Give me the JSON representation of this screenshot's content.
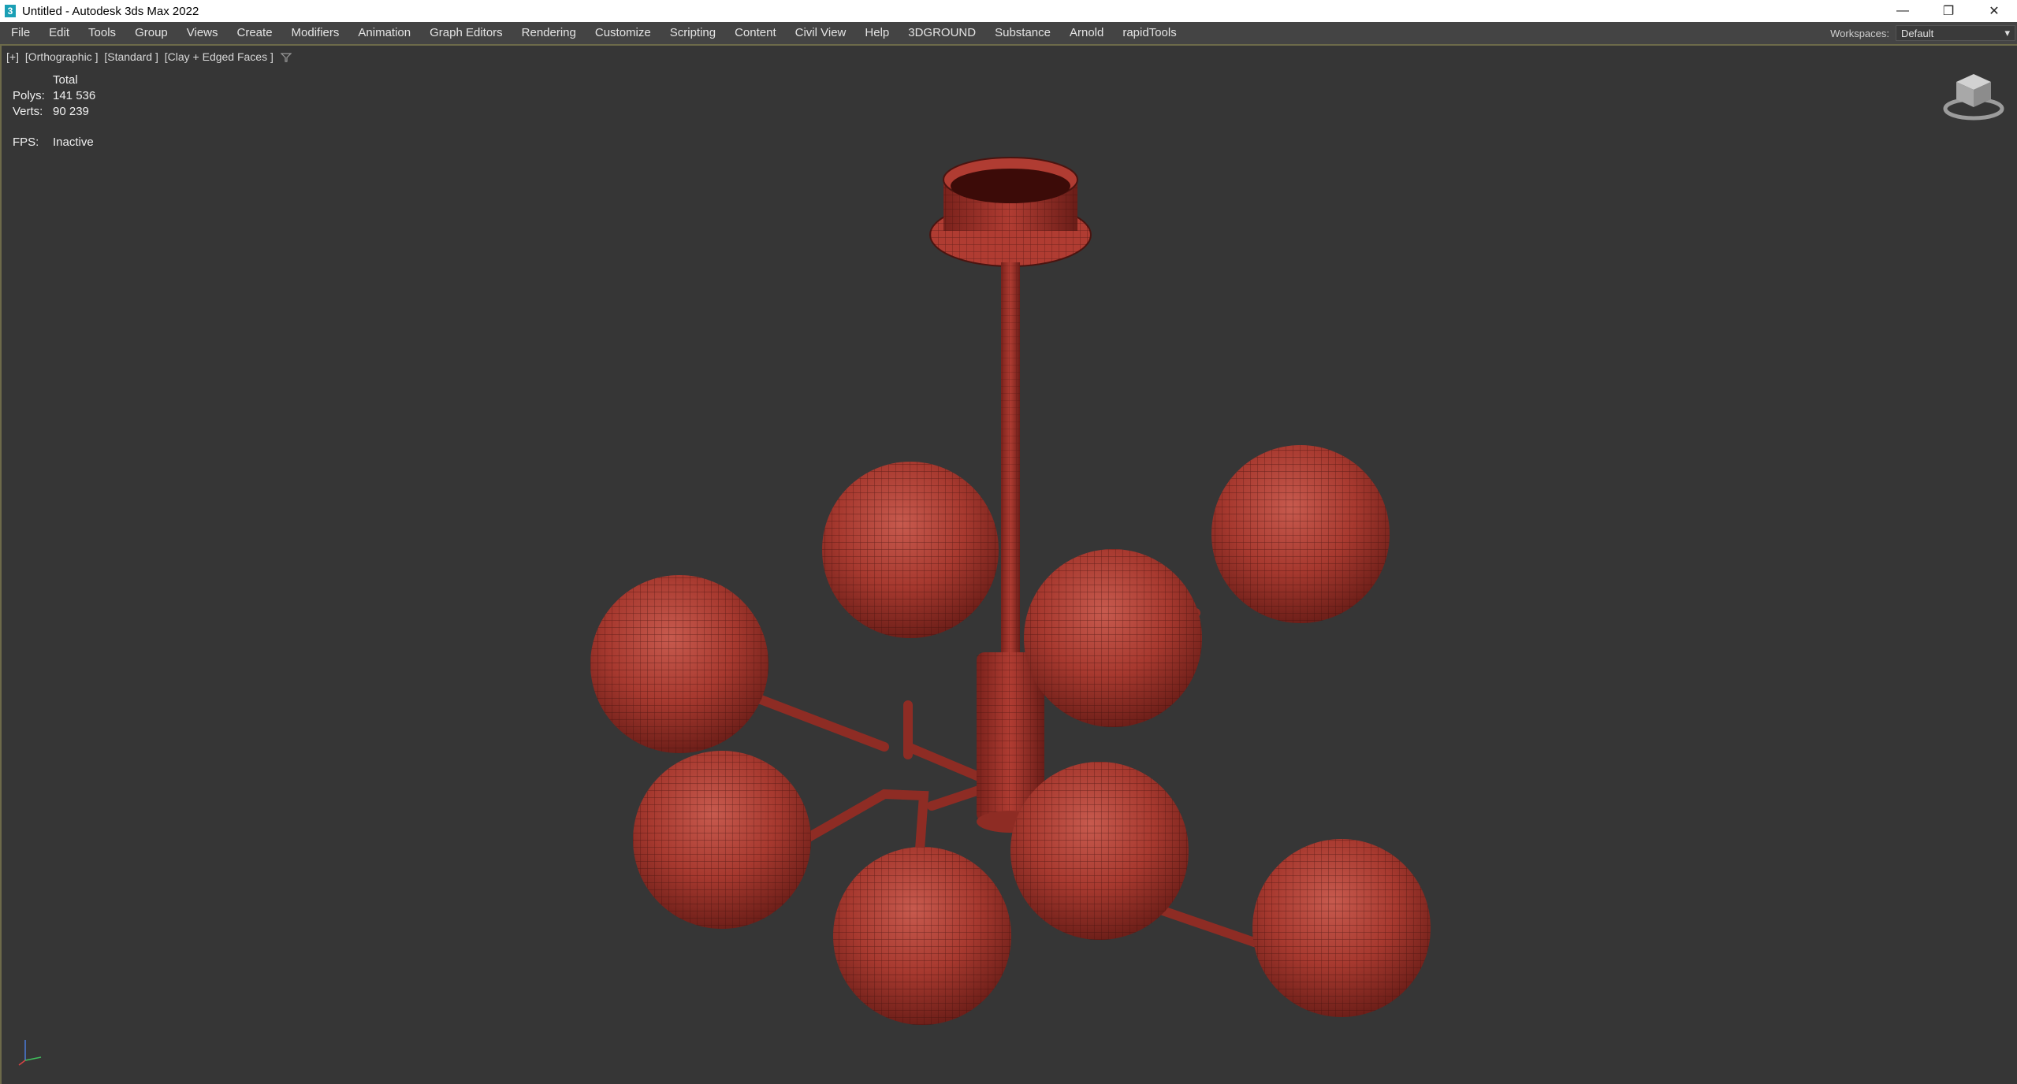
{
  "window": {
    "title": "Untitled - Autodesk 3ds Max 2022",
    "app_icon_glyph": "3",
    "controls": {
      "minimize": "—",
      "restore": "❐",
      "close": "✕"
    }
  },
  "menubar": {
    "items": [
      {
        "label": "File"
      },
      {
        "label": "Edit"
      },
      {
        "label": "Tools"
      },
      {
        "label": "Group"
      },
      {
        "label": "Views"
      },
      {
        "label": "Create"
      },
      {
        "label": "Modifiers"
      },
      {
        "label": "Animation"
      },
      {
        "label": "Graph Editors"
      },
      {
        "label": "Rendering"
      },
      {
        "label": "Customize"
      },
      {
        "label": "Scripting"
      },
      {
        "label": "Content"
      },
      {
        "label": "Civil View"
      },
      {
        "label": "Help"
      },
      {
        "label": "3DGROUND"
      },
      {
        "label": "Substance"
      },
      {
        "label": "Arnold"
      },
      {
        "label": "rapidTools"
      }
    ],
    "workspace_label": "Workspaces:",
    "workspace_value": "Default"
  },
  "viewport": {
    "labels": [
      "[+]",
      "[Orthographic ]",
      "[Standard ]",
      "[Clay + Edged Faces ]"
    ],
    "stats": {
      "header": "Total",
      "polys_label": "Polys:",
      "polys_value": "141 536",
      "verts_label": "Verts:",
      "verts_value": "90 239",
      "fps_label": "FPS:",
      "fps_value": "Inactive"
    },
    "model_color": "#b03c32",
    "background_color": "#363636"
  }
}
